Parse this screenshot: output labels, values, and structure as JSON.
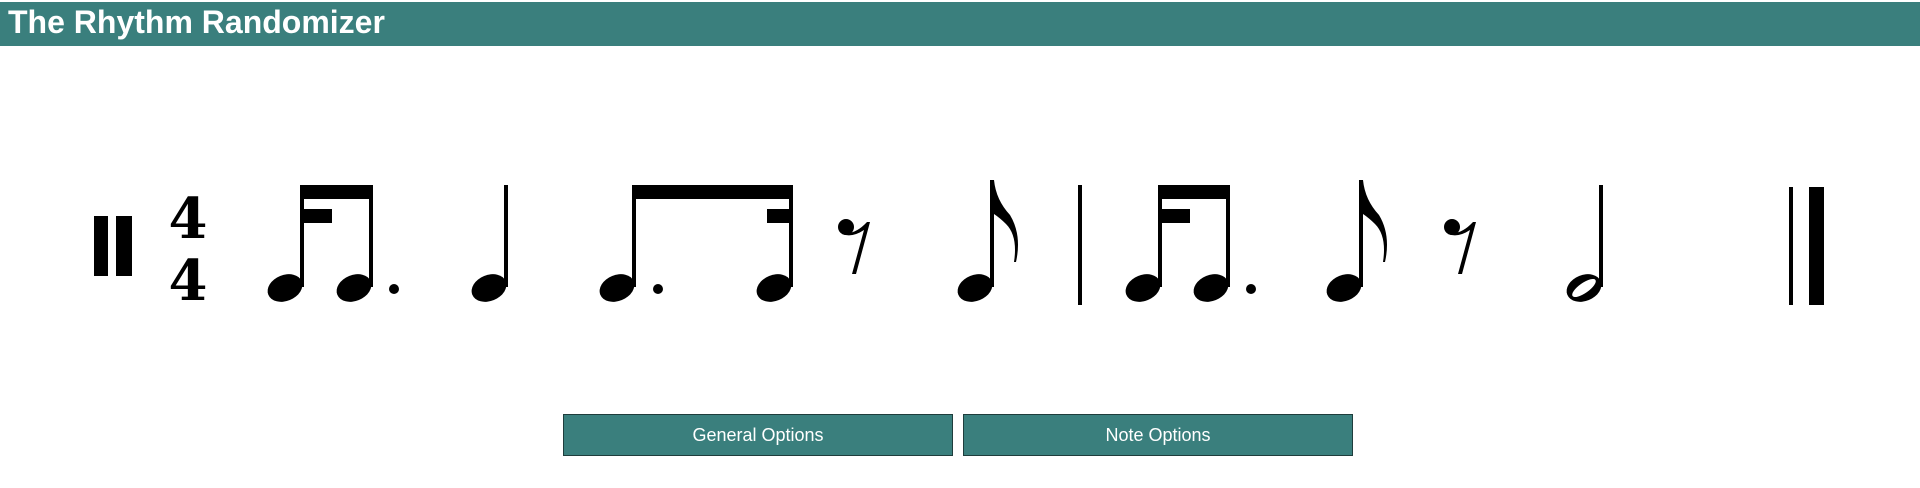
{
  "app": {
    "title": "The Rhythm Randomizer",
    "accent_color": "#3a7f7d"
  },
  "score": {
    "time_signature": {
      "numerator": "4",
      "denominator": "4"
    },
    "measures": [
      {
        "elements": [
          "sixteenth-dotted-eighth beamed pair",
          "quarter note",
          "dotted-eighth-sixteenth beamed pair",
          "eighth rest",
          "eighth note"
        ]
      },
      {
        "elements": [
          "sixteenth-dotted-eighth beamed pair",
          "eighth note",
          "eighth rest",
          "half note"
        ]
      }
    ],
    "start_bar": "repeat-style double bar",
    "end_bar": "final double bar"
  },
  "controls": {
    "general_options_label": "General Options",
    "note_options_label": "Note Options"
  }
}
